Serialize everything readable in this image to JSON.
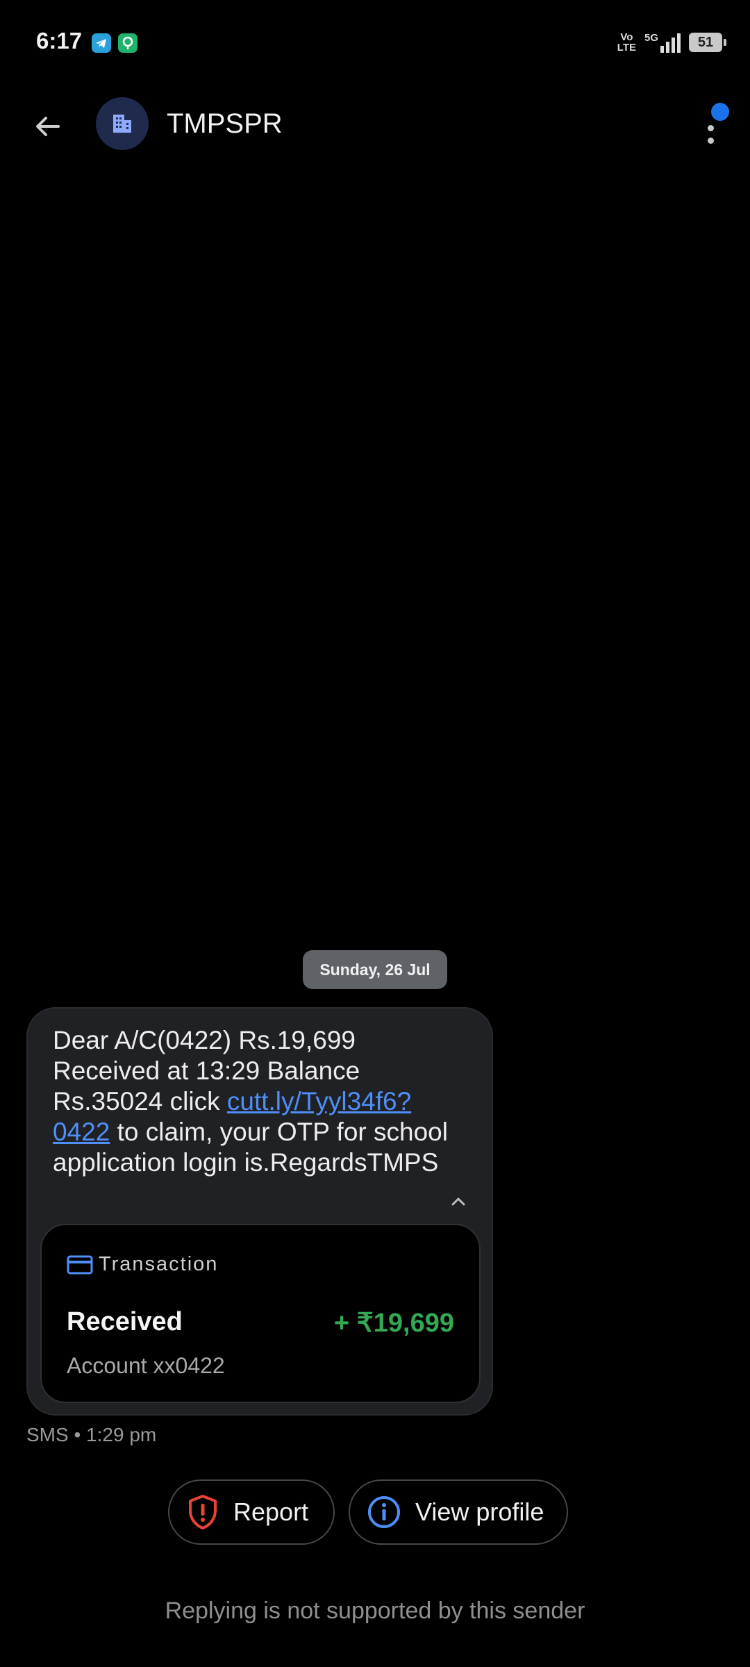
{
  "status_bar": {
    "time": "6:17",
    "network_type": "5G",
    "volte_label_top": "Vo",
    "volte_label_bottom": "LTE",
    "battery_level": "51",
    "icons": [
      "telegram-icon",
      "app-notification-icon",
      "volte-icon",
      "signal-icon",
      "battery-icon"
    ]
  },
  "app_bar": {
    "sender_name": "TMPSPR",
    "avatar_icon": "business-icon",
    "has_unread_indicator": true,
    "accent_color": "#1a73e8"
  },
  "conversation": {
    "date_chip": "Sunday, 26 Jul",
    "message": {
      "text_before_link": "Dear A/C(0422) Rs.19,699 Received at 13:29 Balance Rs.35024 click ",
      "link_text": "cutt.ly/Tyyl34f6?0422",
      "text_after_link": " to claim, your OTP for school application login is.RegardsTMPS",
      "meta": "SMS • 1:29 pm"
    },
    "transaction_card": {
      "title": "Transaction",
      "status": "Received",
      "amount": "+ ₹19,699",
      "account": "Account xx0422",
      "amount_color": "#34a853"
    }
  },
  "actions": {
    "report_label": "Report",
    "view_profile_label": "View profile"
  },
  "footer": {
    "note": "Replying is not supported by this sender"
  }
}
